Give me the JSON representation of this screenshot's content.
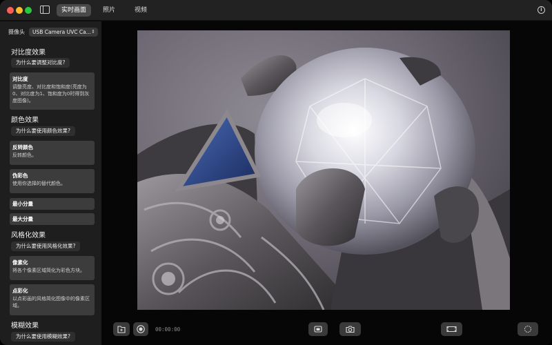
{
  "toolbar": {
    "tabs": [
      {
        "label": "实时画面",
        "active": true
      },
      {
        "label": "照片",
        "active": false
      },
      {
        "label": "视频",
        "active": false
      }
    ],
    "info_icon": "info-icon",
    "info_glyph": "i"
  },
  "sidebar": {
    "camera_label": "摄像头",
    "camera_value": "USB Camera UVC Ca...",
    "chevron": "⇕",
    "sections": {
      "contrast": {
        "title": "对比度效果",
        "why": "为什么要调整对比度?",
        "items": [
          {
            "title": "对比度",
            "desc": "调整亮度、对比度和饱和度(亮度为0、对比度为1、饱和度为0时得到灰度图像)。"
          }
        ]
      },
      "color": {
        "title": "颜色效果",
        "why": "为什么要使用颜色效果?",
        "items": [
          {
            "title": "反转颜色",
            "desc": "反转颜色。"
          },
          {
            "title": "伪彩色",
            "desc": "使用你选择的替代颜色。"
          },
          {
            "title": "最小分量",
            "desc": ""
          },
          {
            "title": "最大分量",
            "desc": ""
          }
        ]
      },
      "stylize": {
        "title": "风格化效果",
        "why": "为什么要使用风格化效果?",
        "items": [
          {
            "title": "像素化",
            "desc": "将各个像素区域简化为彩色方块。"
          },
          {
            "title": "点彩化",
            "desc": "以点彩画的风格简化图像中的像素区域。"
          }
        ]
      },
      "blur": {
        "title": "模糊效果",
        "why": "为什么要使用模糊效果?"
      }
    }
  },
  "bottom_bar": {
    "timer": "00:00:00",
    "icons": [
      "folder-icon",
      "record-icon",
      "photo-library-icon",
      "camera-icon",
      "aspect-ratio-icon",
      "settings-icon"
    ]
  },
  "colors": {
    "accent_tab": "#4a4a4a",
    "sidebar_bg": "#1e1e1e",
    "card_bg": "#3c3c3c"
  }
}
